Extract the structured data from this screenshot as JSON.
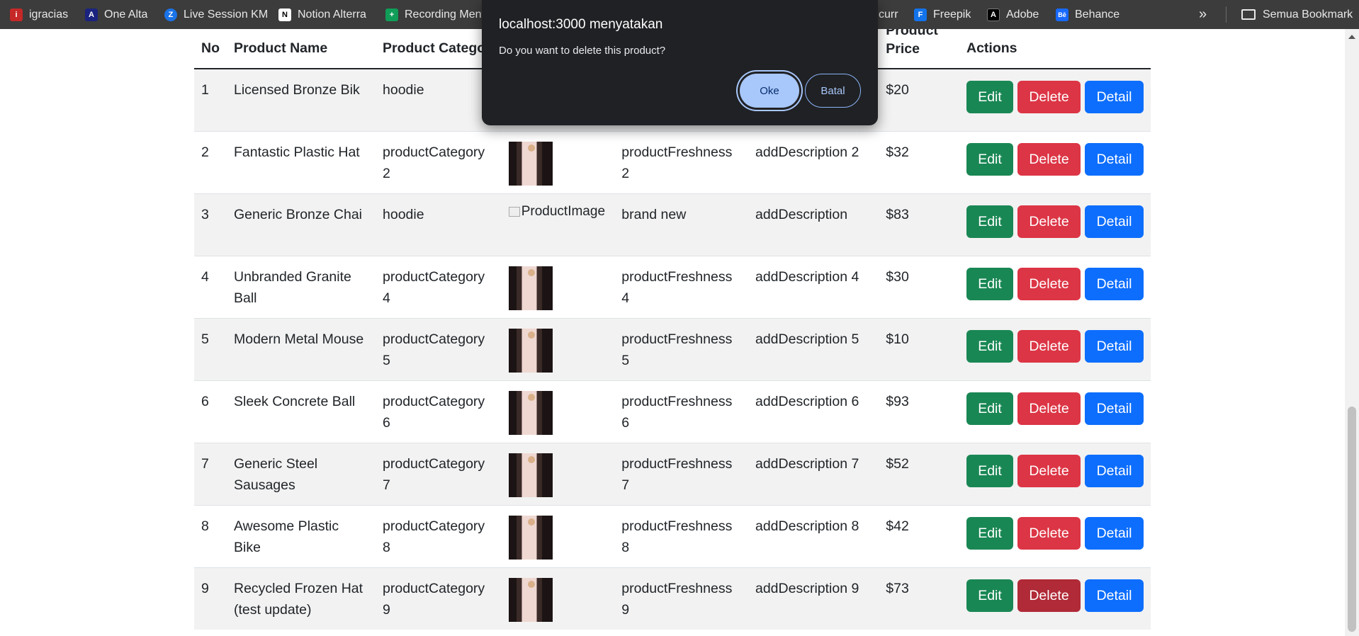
{
  "bookmarks": [
    {
      "label": "igracias",
      "icon": "igracias-icon",
      "color": "#c62828",
      "glyph": "i"
    },
    {
      "label": "One Alta",
      "icon": "alta-icon",
      "color": "#1a237e",
      "glyph": "A"
    },
    {
      "label": "Live Session KM",
      "icon": "zoom-icon",
      "color": "#1a73e8",
      "glyph": "Z"
    },
    {
      "label": "Notion Alterra",
      "icon": "notion-icon",
      "color": "#ffffff",
      "glyph": "N"
    },
    {
      "label": "Recording Ment",
      "icon": "sheets-icon",
      "color": "#0f9d58",
      "glyph": "+"
    },
    {
      "label": "curr",
      "icon": "bookmark-icon",
      "color": "#555555",
      "glyph": ""
    },
    {
      "label": "Freepik",
      "icon": "freepik-icon",
      "color": "#1273eb",
      "glyph": "F"
    },
    {
      "label": "Adobe",
      "icon": "adobe-icon",
      "color": "#000000",
      "glyph": "A"
    },
    {
      "label": "Behance",
      "icon": "behance-icon",
      "color": "#1769ff",
      "glyph": "Bē"
    }
  ],
  "bookmarks_more": "»",
  "all_bookmarks_label": "Semua Bookmark",
  "table": {
    "headers": {
      "no": "No",
      "name": "Product Name",
      "category": "Product Catego",
      "price": "Product Price",
      "actions": "Actions"
    },
    "rows": [
      {
        "no": "1",
        "name": "Licensed Bronze Bik",
        "category": "hoodie",
        "image": "thumb",
        "freshness": "",
        "description": "",
        "price": "$20"
      },
      {
        "no": "2",
        "name": "Fantastic Plastic Hat",
        "category": "productCategory 2",
        "image": "thumb",
        "freshness": "productFreshness 2",
        "description": "addDescription 2",
        "price": "$32"
      },
      {
        "no": "3",
        "name": "Generic Bronze Chai",
        "category": "hoodie",
        "image": "broken",
        "freshness": "brand new",
        "description": "addDescription",
        "price": "$83"
      },
      {
        "no": "4",
        "name": "Unbranded Granite Ball",
        "category": "productCategory 4",
        "image": "thumb",
        "freshness": "productFreshness 4",
        "description": "addDescription 4",
        "price": "$30"
      },
      {
        "no": "5",
        "name": "Modern Metal Mouse",
        "category": "productCategory 5",
        "image": "thumb",
        "freshness": "productFreshness 5",
        "description": "addDescription 5",
        "price": "$10"
      },
      {
        "no": "6",
        "name": "Sleek Concrete Ball",
        "category": "productCategory 6",
        "image": "thumb",
        "freshness": "productFreshness 6",
        "description": "addDescription 6",
        "price": "$93"
      },
      {
        "no": "7",
        "name": "Generic Steel Sausages",
        "category": "productCategory 7",
        "image": "thumb",
        "freshness": "productFreshness 7",
        "description": "addDescription 7",
        "price": "$52"
      },
      {
        "no": "8",
        "name": "Awesome Plastic Bike",
        "category": "productCategory 8",
        "image": "thumb",
        "freshness": "productFreshness 8",
        "description": "addDescription 8",
        "price": "$42"
      },
      {
        "no": "9",
        "name": "Recycled Frozen Hat (test update)",
        "category": "productCategory 9",
        "image": "thumb",
        "freshness": "productFreshness 9",
        "description": "addDescription 9",
        "price": "$73"
      }
    ],
    "broken_image_alt": "ProductImage",
    "buttons": {
      "edit": "Edit",
      "delete": "Delete",
      "detail": "Detail"
    },
    "button_colors": {
      "edit": "#198754",
      "delete": "#dc3545",
      "detail": "#0d6efd"
    }
  },
  "dialog": {
    "title": "localhost:3000 menyatakan",
    "message": "Do you want to delete this product?",
    "ok_label": "Oke",
    "cancel_label": "Batal"
  }
}
